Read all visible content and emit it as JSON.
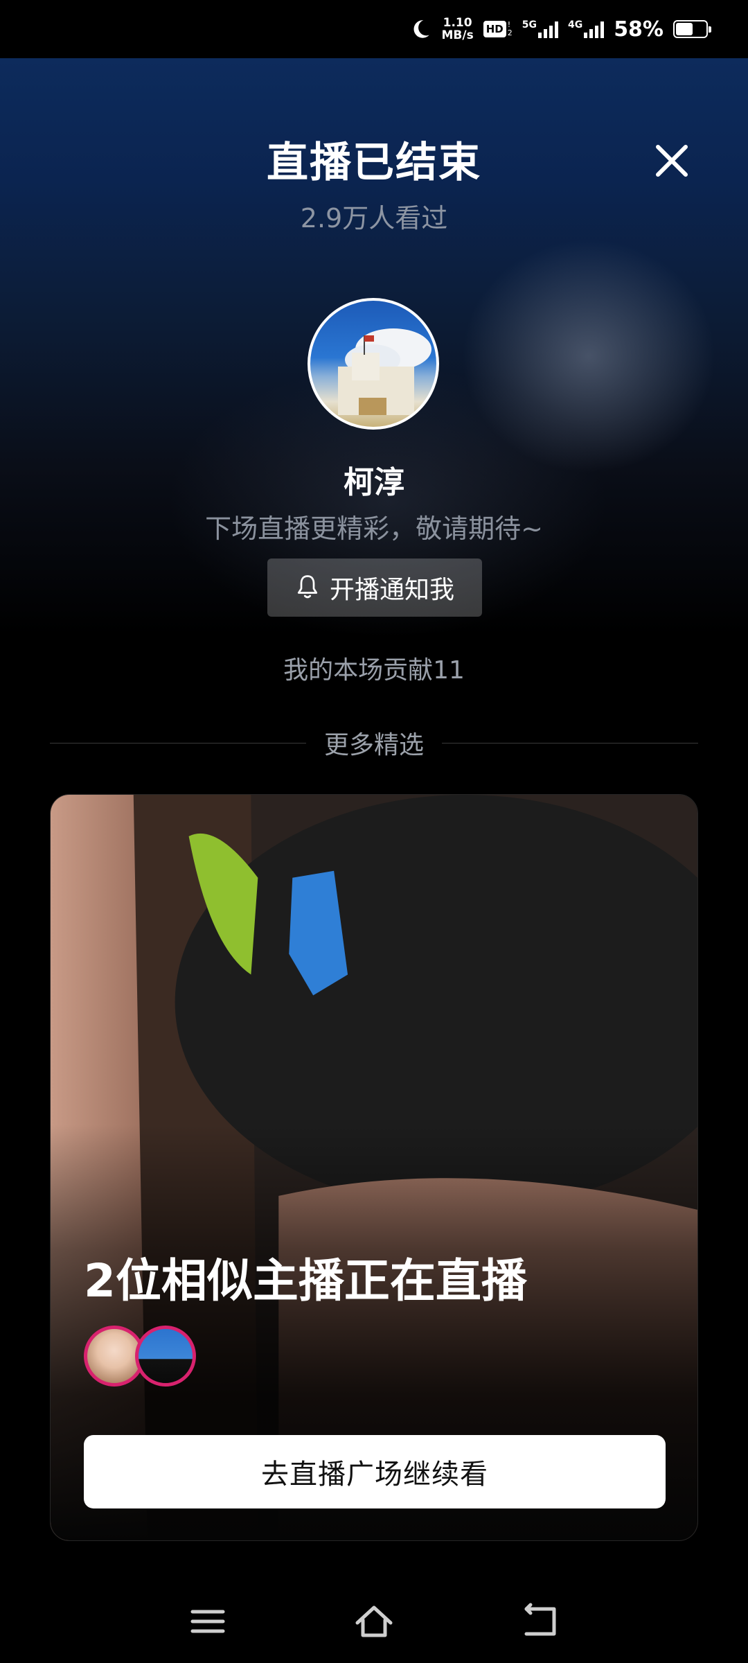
{
  "status_bar": {
    "net_speed_value": "1.10",
    "net_speed_unit": "MB/s",
    "hd_label": "HD",
    "hd_sub_top": "!",
    "hd_sub_bottom": "2",
    "signal1_label": "5G",
    "signal2_label": "4G",
    "battery_percent": "58%",
    "battery_level": 0.58
  },
  "header": {
    "title": "直播已结束",
    "viewers": "2.9万人看过"
  },
  "streamer": {
    "name": "柯淳",
    "tagline": "下场直播更精彩，敬请期待~",
    "notify_label": "开播通知我",
    "contribution": "我的本场贡献11"
  },
  "more_section": {
    "label": "更多精选"
  },
  "card": {
    "title": "2位相似主播正在直播",
    "cta_label": "去直播广场继续看"
  },
  "colors": {
    "accent_ring": "#d8226e",
    "hero_top": "#0d2b5c"
  }
}
